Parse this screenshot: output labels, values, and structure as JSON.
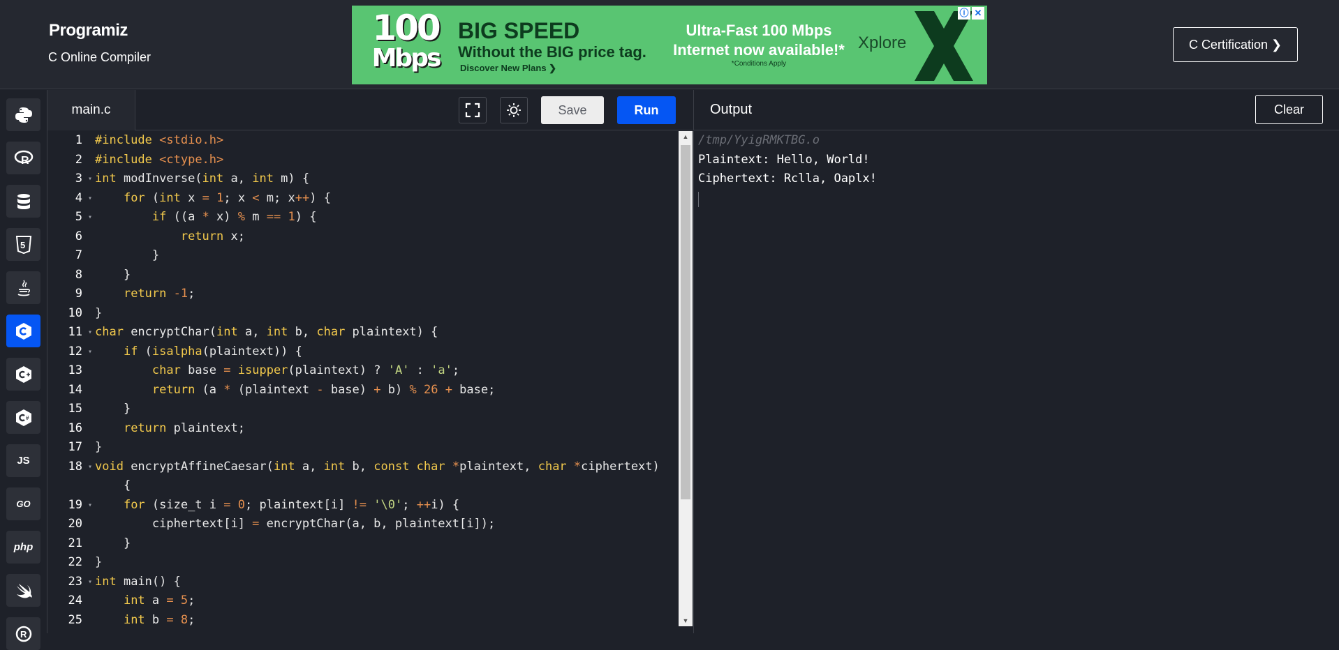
{
  "header": {
    "logo": "Programiz",
    "subtitle": "C Online Compiler",
    "cert_button": "C Certification ❯"
  },
  "ad": {
    "speed_number": "100",
    "speed_unit": "Mbps",
    "headline": "BIG SPEED",
    "subline": "Without the BIG price tag.",
    "cta": "Discover New Plans ❯",
    "offer_line1": "Ultra-Fast 100 Mbps",
    "offer_line2": "Internet now available!*",
    "conditions": "*Conditions Apply",
    "brand": "Xplore",
    "brand_color": "#0d3b1e",
    "background_color": "#59c572"
  },
  "sidebar": {
    "items": [
      {
        "name": "python",
        "icon": "python-icon",
        "active": false
      },
      {
        "name": "r",
        "icon": "r-icon",
        "active": false
      },
      {
        "name": "sql",
        "icon": "database-icon",
        "active": false
      },
      {
        "name": "html",
        "icon": "html5-icon",
        "active": false
      },
      {
        "name": "java",
        "icon": "java-icon",
        "active": false
      },
      {
        "name": "c",
        "icon": "c-icon",
        "active": true
      },
      {
        "name": "cpp",
        "icon": "cpp-icon",
        "active": false
      },
      {
        "name": "csharp",
        "icon": "csharp-icon",
        "active": false
      },
      {
        "name": "js",
        "label": "JS",
        "icon": "js-icon",
        "active": false
      },
      {
        "name": "go",
        "label": "GO",
        "icon": "go-icon",
        "active": false
      },
      {
        "name": "php",
        "label": "php",
        "icon": "php-icon",
        "active": false
      },
      {
        "name": "swift",
        "icon": "swift-icon",
        "active": false
      },
      {
        "name": "rust",
        "icon": "rust-icon",
        "active": false
      }
    ]
  },
  "editor": {
    "filename": "main.c",
    "save_label": "Save",
    "run_label": "Run",
    "accent_color": "#0556f3",
    "lines": [
      "1",
      "2",
      "3",
      "4",
      "5",
      "6",
      "7",
      "8",
      "9",
      "10",
      "11",
      "12",
      "13",
      "14",
      "15",
      "16",
      "17",
      "18",
      "",
      "19",
      "20",
      "21",
      "22",
      "23",
      "24",
      "25"
    ]
  },
  "output": {
    "title": "Output",
    "clear_label": "Clear",
    "path": "/tmp/YyigRMKTBG.o",
    "line1": "Plaintext: Hello, World!",
    "line2": "Ciphertext: Rclla, Oaplx!"
  }
}
